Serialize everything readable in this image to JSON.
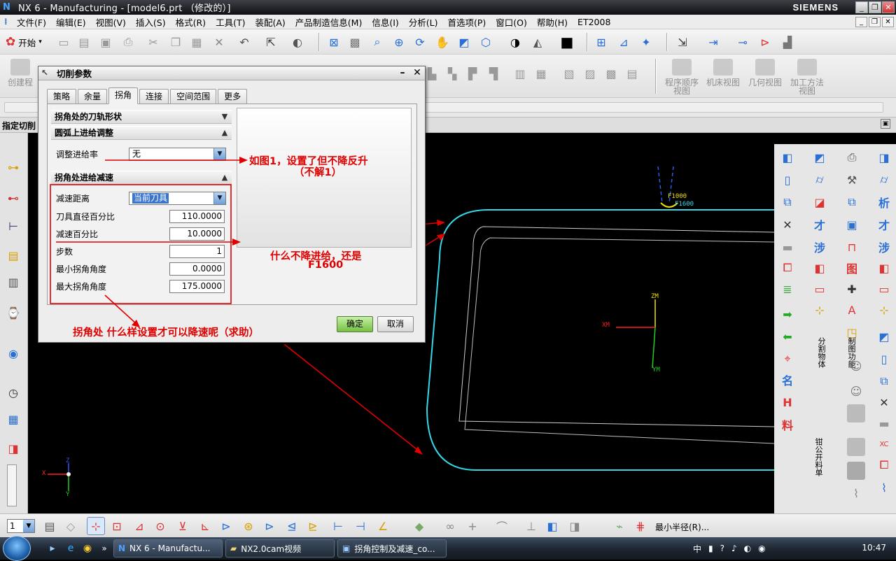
{
  "window": {
    "title": "NX 6 - Manufacturing - [model6.prt （修改的）]",
    "brand": "SIEMENS",
    "btn_minimize": "_",
    "btn_restore": "❐",
    "btn_close": "✕"
  },
  "menubar": {
    "items": [
      "文件(F)",
      "编辑(E)",
      "视图(V)",
      "插入(S)",
      "格式(R)",
      "工具(T)",
      "装配(A)",
      "产品制造信息(M)",
      "信息(I)",
      "分析(L)",
      "首选项(P)",
      "窗口(O)",
      "帮助(H)",
      "ET2008"
    ]
  },
  "toolbar1": {
    "start_label": "开始"
  },
  "toolbar2": {
    "left_label": "创建程",
    "tools": [
      "程序顺序视图",
      "机床视图",
      "几何视图",
      "加工方法视图"
    ]
  },
  "prompt": {
    "text": "指定切削"
  },
  "dialog": {
    "title": "切削参数",
    "tabs": [
      "策略",
      "余量",
      "拐角",
      "连接",
      "空间范围",
      "更多"
    ],
    "active_tab": "拐角",
    "groups": {
      "corner_path": "拐角处的刀轨形状",
      "arc_feed": "圆弧上进给调整",
      "corner_slowdown": "拐角处进给减速"
    },
    "fields": {
      "adjust_feed_label": "调整进给率",
      "adjust_feed_value": "无",
      "slowdown_distance_label": "减速距离",
      "slowdown_distance_value": "当前刀具",
      "tool_diameter_pct_label": "刀具直径百分比",
      "tool_diameter_pct_value": "110.0000",
      "slowdown_pct_label": "减速百分比",
      "slowdown_pct_value": "10.0000",
      "steps_label": "步数",
      "steps_value": "1",
      "min_corner_angle_label": "最小拐角角度",
      "min_corner_angle_value": "0.0000",
      "max_corner_angle_label": "最大拐角角度",
      "max_corner_angle_value": "175.0000"
    },
    "ok_label": "确定",
    "cancel_label": "取消"
  },
  "annotations": {
    "note1_line1": "如图1，设置了但不降反升",
    "note1_line2": "（不解1）",
    "note2_line1": "什么不降进给，还是",
    "note2_line2": "F1600",
    "note3": "拐角处 什么样设置才可以降速呢（求助）"
  },
  "viewport": {
    "feed_label_1": "F1000",
    "feed_label_2": "F1600",
    "axis_zm": "ZM",
    "axis_xm": "XM",
    "axis_ym": "YM",
    "axis_x": "X",
    "axis_y": "Y",
    "axis_z": "Z"
  },
  "right_panel": {
    "vertical_labels": [
      "分割物体",
      "制图功能",
      "钳公开料单"
    ]
  },
  "bottombar": {
    "layer_value": "1",
    "min_radius_label": "最小半径(R)..."
  },
  "taskbar": {
    "tasks": [
      "NX 6 - Manufactu...",
      "NX2.0cam视频",
      "拐角控制及减速_co..."
    ],
    "clock": "10:47",
    "ime": "中"
  },
  "colors": {
    "annotation": "#e00000",
    "part_outline": "#35d7e6",
    "toolpath": "#ffffff"
  }
}
